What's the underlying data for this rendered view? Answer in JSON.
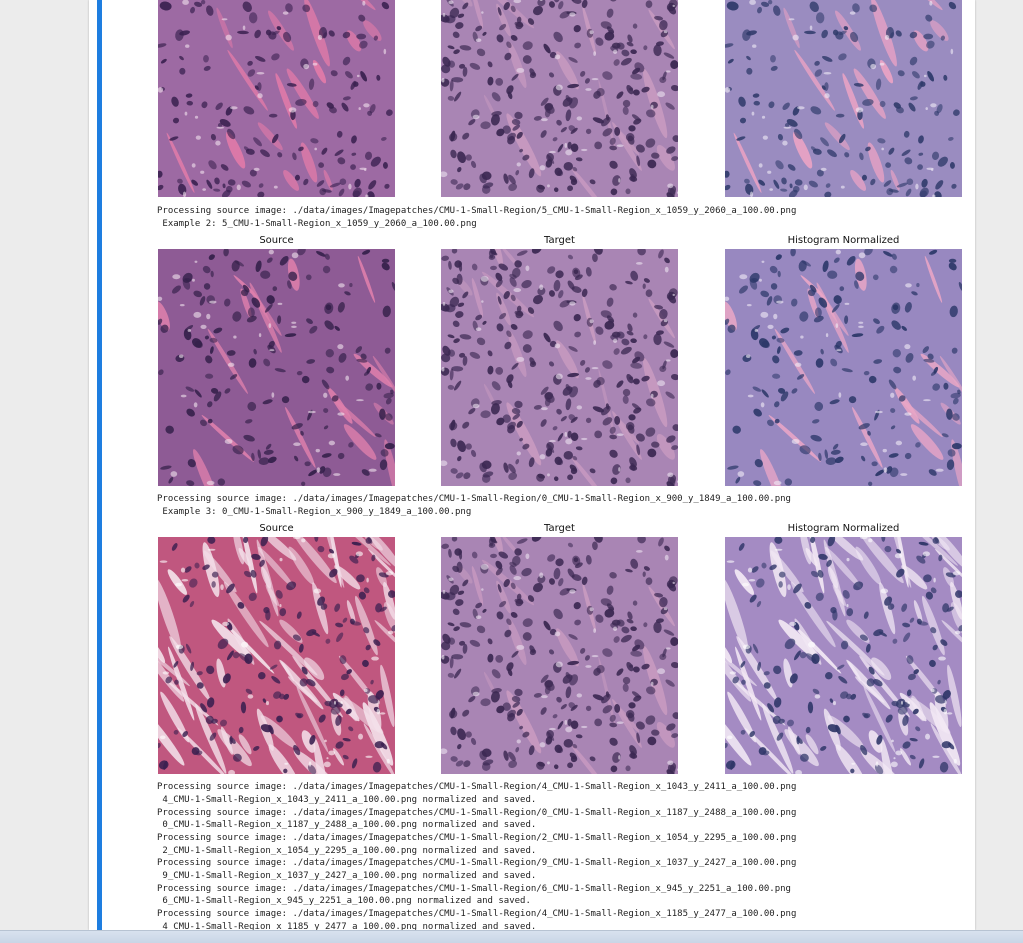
{
  "titles": {
    "source": "Source",
    "target": "Target",
    "normalized": "Histogram Normalized"
  },
  "examples": [
    {
      "processing": "Processing source image: ./data/images/Imagepatches/CMU-1-Small-Region/5_CMU-1-Small-Region_x_1059_y_2060_a_100.00.png",
      "example": " Example 2: 5_CMU-1-Small-Region_x_1059_y_2060_a_100.00.png"
    },
    {
      "processing": "Processing source image: ./data/images/Imagepatches/CMU-1-Small-Region/0_CMU-1-Small-Region_x_900_y_1849_a_100.00.png",
      "example": " Example 3: 0_CMU-1-Small-Region_x_900_y_1849_a_100.00.png"
    }
  ],
  "log_lines": [
    "Processing source image: ./data/images/Imagepatches/CMU-1-Small-Region/4_CMU-1-Small-Region_x_1043_y_2411_a_100.00.png",
    " 4_CMU-1-Small-Region_x_1043_y_2411_a_100.00.png normalized and saved.",
    "Processing source image: ./data/images/Imagepatches/CMU-1-Small-Region/0_CMU-1-Small-Region_x_1187_y_2488_a_100.00.png",
    " 0_CMU-1-Small-Region_x_1187_y_2488_a_100.00.png normalized and saved.",
    "Processing source image: ./data/images/Imagepatches/CMU-1-Small-Region/2_CMU-1-Small-Region_x_1054_y_2295_a_100.00.png",
    " 2_CMU-1-Small-Region_x_1054_y_2295_a_100.00.png normalized and saved.",
    "Processing source image: ./data/images/Imagepatches/CMU-1-Small-Region/9_CMU-1-Small-Region_x_1037_y_2427_a_100.00.png",
    " 9_CMU-1-Small-Region_x_1037_y_2427_a_100.00.png normalized and saved.",
    "Processing source image: ./data/images/Imagepatches/CMU-1-Small-Region/6_CMU-1-Small-Region_x_945_y_2251_a_100.00.png",
    " 6_CMU-1-Small-Region_x_945_y_2251_a_100.00.png normalized and saved.",
    "Processing source image: ./data/images/Imagepatches/CMU-1-Small-Region/4_CMU-1-Small-Region_x_1185_y_2477_a_100.00.png",
    " 4_CMU-1-Small-Region_x_1185_y_2477_a_100.00.png normalized and saved."
  ],
  "colors": {
    "active_bar": "#1e7ee0",
    "tissue_pink": "#d77aa6",
    "tissue_purple": "#9c5f9a",
    "nuclei_dark": "#3b2450",
    "normalized_tint": "#9c86c4"
  }
}
